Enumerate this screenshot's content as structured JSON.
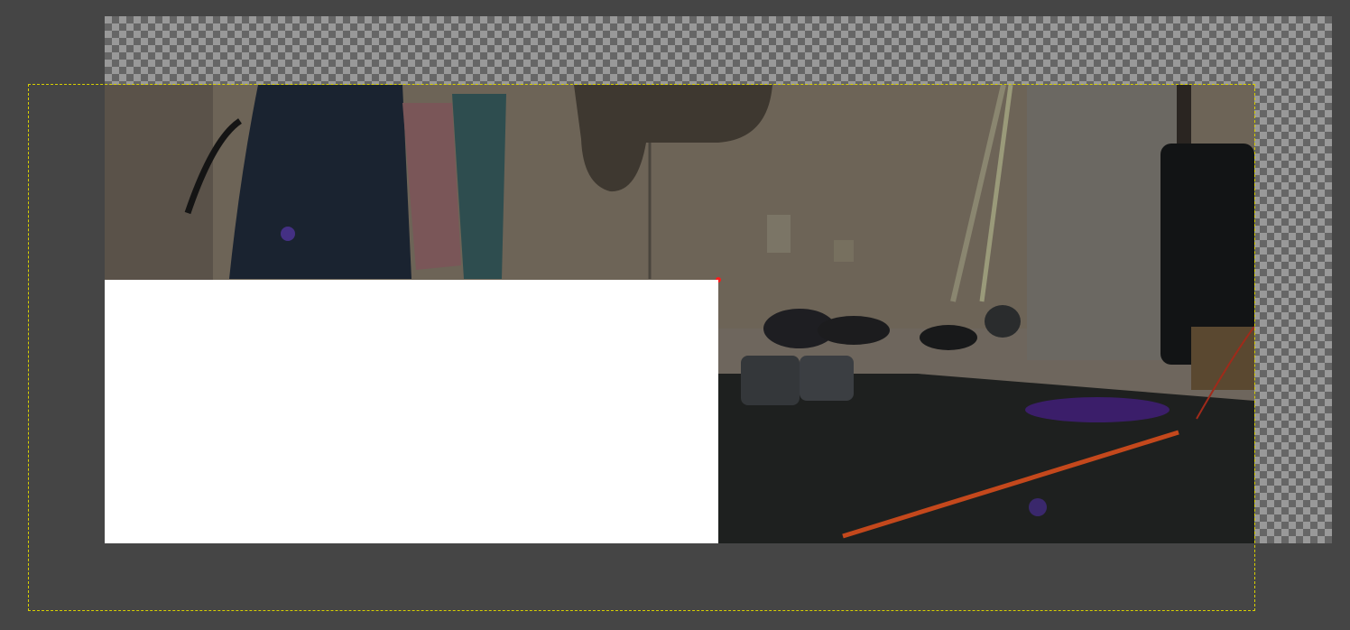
{
  "canvas": {
    "background_color": "#454545",
    "checker_dark": "#666666",
    "checker_light": "#999999",
    "boundary_color": "#d8d000",
    "fill_color": "#ffffff"
  },
  "photo": {
    "description_icon": "photo-layer-icon"
  }
}
